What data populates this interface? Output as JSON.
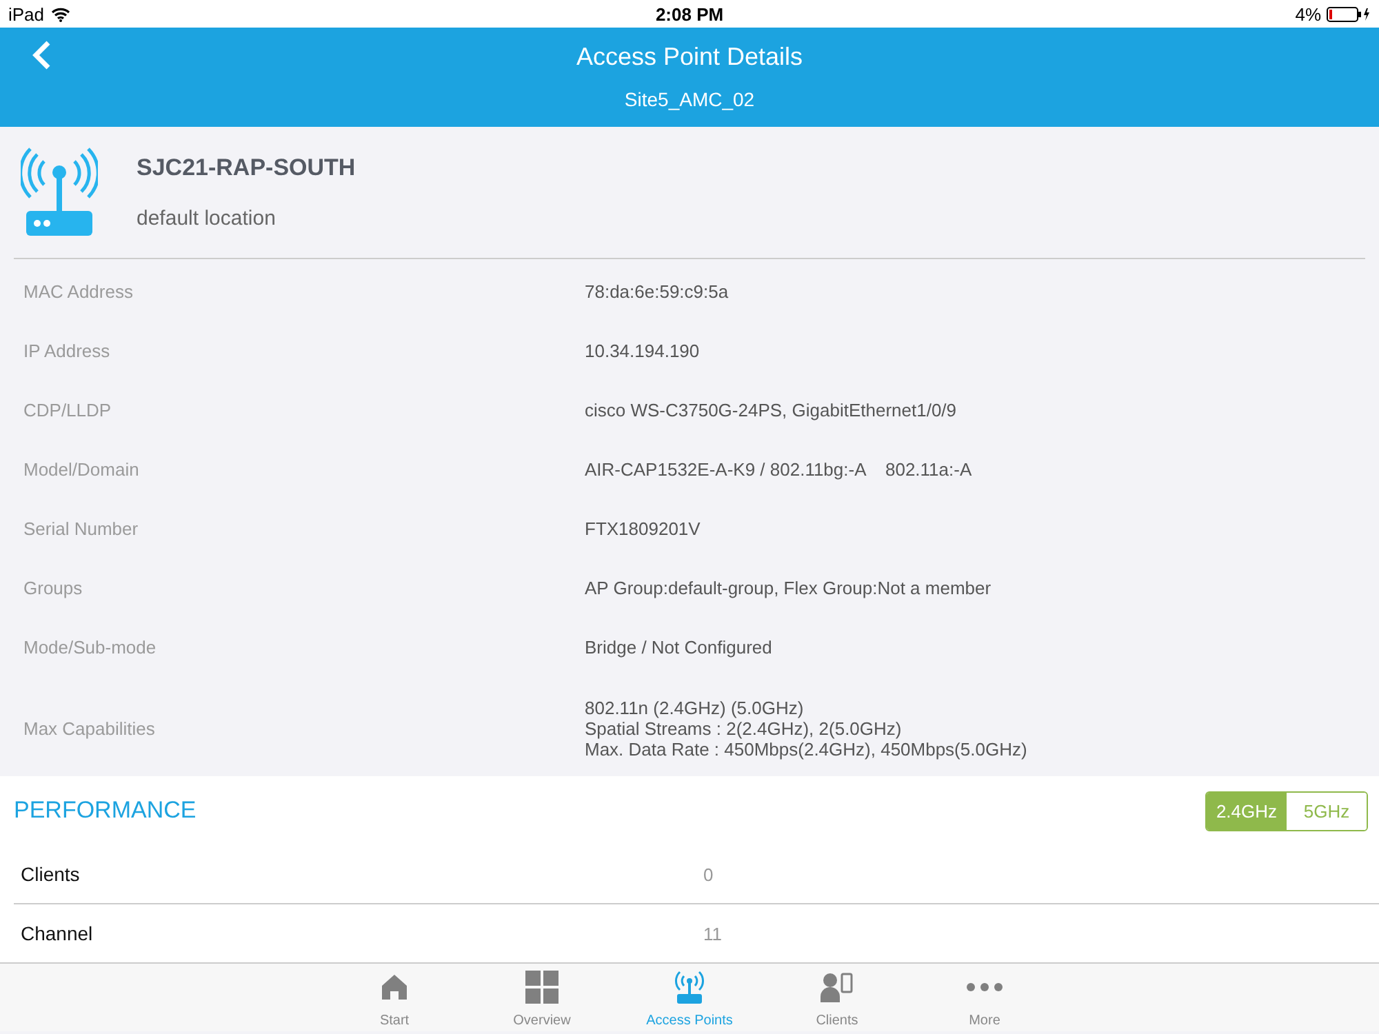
{
  "status_bar": {
    "device": "iPad",
    "time": "2:08 PM",
    "battery": "4%"
  },
  "header": {
    "title": "Access Point Details",
    "subtitle": "Site5_AMC_02"
  },
  "access_point": {
    "name": "SJC21-RAP-SOUTH",
    "location": "default location"
  },
  "details": [
    {
      "label": "MAC Address",
      "lines": [
        "78:da:6e:59:c9:5a"
      ]
    },
    {
      "label": "IP Address",
      "lines": [
        "10.34.194.190"
      ]
    },
    {
      "label": "CDP/LLDP",
      "lines": [
        "cisco WS-C3750G-24PS, GigabitEthernet1/0/9"
      ]
    },
    {
      "label": "Model/Domain",
      "lines": [
        "AIR-CAP1532E-A-K9 / 802.11bg:-A    802.11a:-A"
      ]
    },
    {
      "label": "Serial Number",
      "lines": [
        "FTX1809201V"
      ]
    },
    {
      "label": "Groups",
      "lines": [
        "AP Group:default-group, Flex Group:Not a member"
      ]
    },
    {
      "label": "Mode/Sub-mode",
      "lines": [
        "Bridge / Not Configured"
      ]
    },
    {
      "label": "Max Capabilities",
      "lines": [
        "802.11n (2.4GHz) (5.0GHz)",
        "Spatial Streams : 2(2.4GHz), 2(5.0GHz)",
        "Max. Data Rate : 450Mbps(2.4GHz), 450Mbps(5.0GHz)"
      ]
    }
  ],
  "performance": {
    "title": "PERFORMANCE",
    "bands": [
      {
        "label": "2.4GHz",
        "selected": true
      },
      {
        "label": "5GHz",
        "selected": false
      }
    ],
    "rows": [
      {
        "label": "Clients",
        "value": "0"
      },
      {
        "label": "Channel",
        "value": "11"
      }
    ]
  },
  "tab_bar": [
    {
      "kind": "home",
      "label": "Start",
      "selected": false
    },
    {
      "kind": "grid",
      "label": "Overview",
      "selected": false
    },
    {
      "kind": "ap",
      "label": "Access Points",
      "selected": true
    },
    {
      "kind": "clients",
      "label": "Clients",
      "selected": false
    },
    {
      "kind": "more",
      "label": "More",
      "selected": false
    }
  ]
}
